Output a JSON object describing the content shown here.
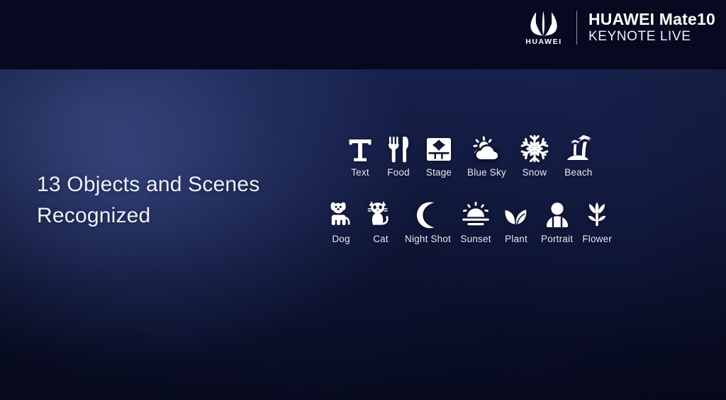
{
  "header": {
    "logo_icon": "huawei-petal-logo-icon",
    "logo_wordmark": "HUAWEI",
    "title": "HUAWEI Mate10",
    "subtitle": "KEYNOTE LIVE"
  },
  "headline": {
    "line1": "13 Objects and Scenes",
    "line2": "Recognized"
  },
  "colors": {
    "band": "#070920",
    "slide_top": "#1c2754",
    "slide_bottom": "#070a1e",
    "text": "#eef0fb",
    "icon": "#ffffff"
  },
  "scenes": {
    "row1": [
      {
        "label": "Text",
        "icon": "text-serif-t-icon"
      },
      {
        "label": "Food",
        "icon": "fork-knife-icon"
      },
      {
        "label": "Stage",
        "icon": "stage-curtain-icon"
      },
      {
        "label": "Blue Sky",
        "icon": "sun-cloud-icon"
      },
      {
        "label": "Snow",
        "icon": "snowflake-icon"
      },
      {
        "label": "Beach",
        "icon": "palm-island-icon"
      }
    ],
    "row2": [
      {
        "label": "Dog",
        "icon": "dog-icon"
      },
      {
        "label": "Cat",
        "icon": "cat-icon"
      },
      {
        "label": "Night Shot",
        "icon": "crescent-moon-icon"
      },
      {
        "label": "Sunset",
        "icon": "sunset-icon"
      },
      {
        "label": "Plant",
        "icon": "leaves-icon"
      },
      {
        "label": "Portrait",
        "icon": "person-bust-icon"
      },
      {
        "label": "Flower",
        "icon": "tulip-icon"
      }
    ]
  }
}
